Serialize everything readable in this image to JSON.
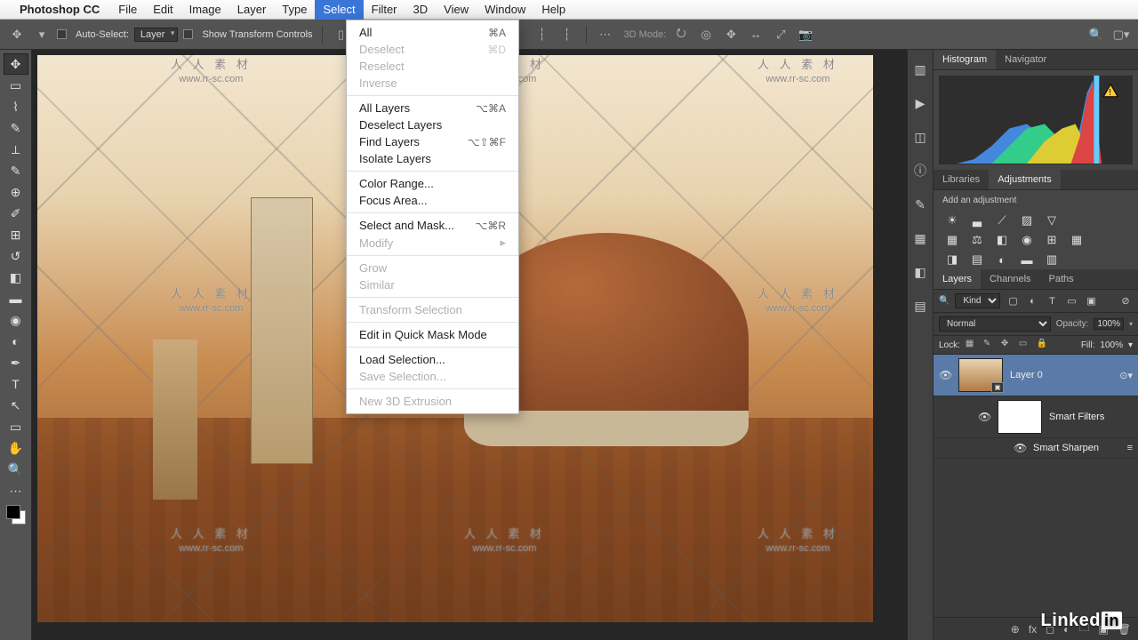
{
  "menubar": {
    "app": "Photoshop CC",
    "items": [
      "File",
      "Edit",
      "Image",
      "Layer",
      "Type",
      "Select",
      "Filter",
      "3D",
      "View",
      "Window",
      "Help"
    ],
    "active_index": 5
  },
  "options": {
    "auto_select": "Auto-Select:",
    "layer": "Layer",
    "show_transform": "Show Transform Controls",
    "mode3d": "3D Mode:"
  },
  "dropdown": [
    {
      "label": "All",
      "shortcut": "⌘A",
      "enabled": true
    },
    {
      "label": "Deselect",
      "shortcut": "⌘D",
      "enabled": false
    },
    {
      "label": "Reselect",
      "shortcut": "",
      "enabled": false
    },
    {
      "label": "Inverse",
      "shortcut": "",
      "enabled": false
    },
    {
      "sep": true
    },
    {
      "label": "All Layers",
      "shortcut": "⌥⌘A",
      "enabled": true
    },
    {
      "label": "Deselect Layers",
      "shortcut": "",
      "enabled": true
    },
    {
      "label": "Find Layers",
      "shortcut": "⌥⇧⌘F",
      "enabled": true
    },
    {
      "label": "Isolate Layers",
      "shortcut": "",
      "enabled": true
    },
    {
      "sep": true
    },
    {
      "label": "Color Range...",
      "shortcut": "",
      "enabled": true
    },
    {
      "label": "Focus Area...",
      "shortcut": "",
      "enabled": true
    },
    {
      "sep": true
    },
    {
      "label": "Select and Mask...",
      "shortcut": "⌥⌘R",
      "enabled": true
    },
    {
      "label": "Modify",
      "shortcut": "",
      "enabled": false,
      "sub": true
    },
    {
      "sep": true
    },
    {
      "label": "Grow",
      "shortcut": "",
      "enabled": false
    },
    {
      "label": "Similar",
      "shortcut": "",
      "enabled": false
    },
    {
      "sep": true
    },
    {
      "label": "Transform Selection",
      "shortcut": "",
      "enabled": false
    },
    {
      "sep": true
    },
    {
      "label": "Edit in Quick Mask Mode",
      "shortcut": "",
      "enabled": true
    },
    {
      "sep": true
    },
    {
      "label": "Load Selection...",
      "shortcut": "",
      "enabled": true
    },
    {
      "label": "Save Selection...",
      "shortcut": "",
      "enabled": false
    },
    {
      "sep": true
    },
    {
      "label": "New 3D Extrusion",
      "shortcut": "",
      "enabled": false
    }
  ],
  "watermark": {
    "cn": "人 人 素 材",
    "url": "www.rr-sc.com"
  },
  "panels": {
    "hist_tabs": [
      "Histogram",
      "Navigator"
    ],
    "lib_tabs": [
      "Libraries",
      "Adjustments"
    ],
    "adj_label": "Add an adjustment",
    "layer_tabs": [
      "Layers",
      "Channels",
      "Paths"
    ],
    "kind": "Kind",
    "blend": "Normal",
    "opacity_label": "Opacity:",
    "opacity": "100%",
    "lock_label": "Lock:",
    "fill_label": "Fill:",
    "fill": "100%",
    "layer0": "Layer 0",
    "smart_filters": "Smart Filters",
    "smart_sharpen": "Smart Sharpen"
  },
  "brand": "Linked"
}
